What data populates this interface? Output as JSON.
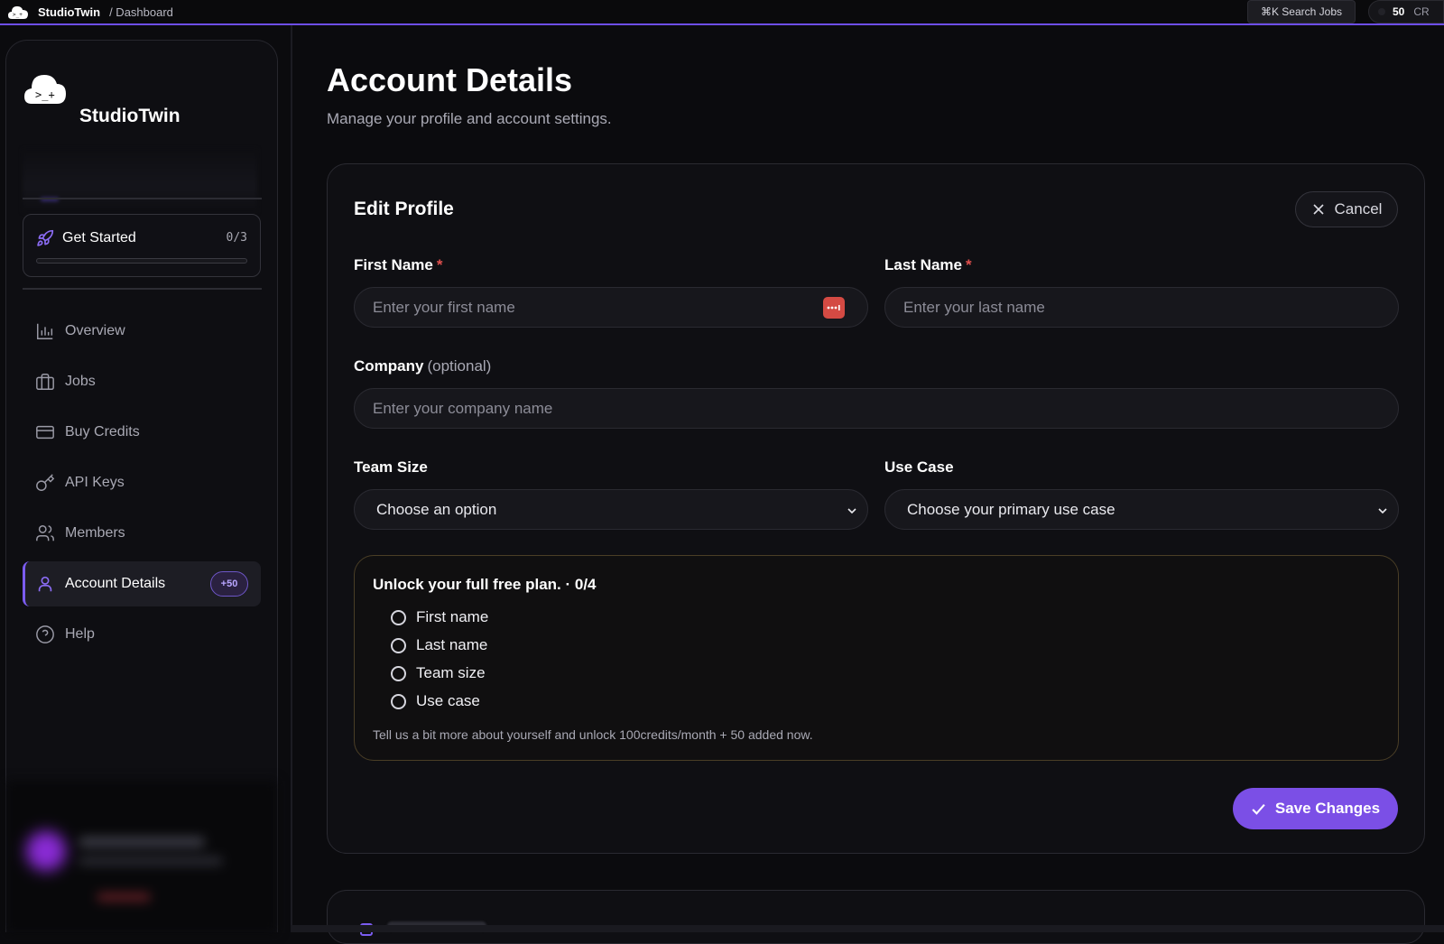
{
  "topbar": {
    "brand": "StudioTwin",
    "breadcrumb": "/ Dashboard",
    "search_label": "⌘K Search Jobs",
    "credits_value": "50",
    "credits_unit": "CR"
  },
  "sidebar": {
    "brand": "StudioTwin",
    "get_started": {
      "label": "Get Started",
      "count": "0/3",
      "progress": 0
    },
    "items": [
      {
        "label": "Overview",
        "icon": "chart-icon"
      },
      {
        "label": "Jobs",
        "icon": "briefcase-icon"
      },
      {
        "label": "Buy Credits",
        "icon": "credit-card-icon"
      },
      {
        "label": "API Keys",
        "icon": "key-icon"
      },
      {
        "label": "Members",
        "icon": "users-icon"
      },
      {
        "label": "Account Details",
        "icon": "user-icon",
        "active": true,
        "badge": "+50"
      },
      {
        "label": "Help",
        "icon": "help-icon"
      }
    ]
  },
  "main": {
    "title": "Account Details",
    "subtitle": "Manage your profile and account settings."
  },
  "edit_profile": {
    "title": "Edit Profile",
    "cancel_label": "Cancel",
    "first_name": {
      "label": "First Name",
      "required": "*",
      "value": "",
      "placeholder": "Enter your first name"
    },
    "last_name": {
      "label": "Last Name",
      "required": "*",
      "value": "",
      "placeholder": "Enter your last name"
    },
    "company": {
      "label": "Company",
      "optional": "(optional)",
      "value": "",
      "placeholder": "Enter your company name"
    },
    "team_size": {
      "label": "Team Size",
      "selected": "Choose an option"
    },
    "use_case": {
      "label": "Use Case",
      "selected": "Choose your primary use case"
    },
    "unlock": {
      "title": "Unlock your full free plan. · 0/4",
      "items": [
        "First name",
        "Last name",
        "Team size",
        "Use case"
      ],
      "note": "Tell us a bit more about yourself and unlock 100credits/month + 50 added now."
    },
    "save_label": "Save Changes"
  },
  "colors": {
    "accent": "#7b4fe6",
    "required": "#e0504e",
    "background": "#0b0b0e"
  }
}
